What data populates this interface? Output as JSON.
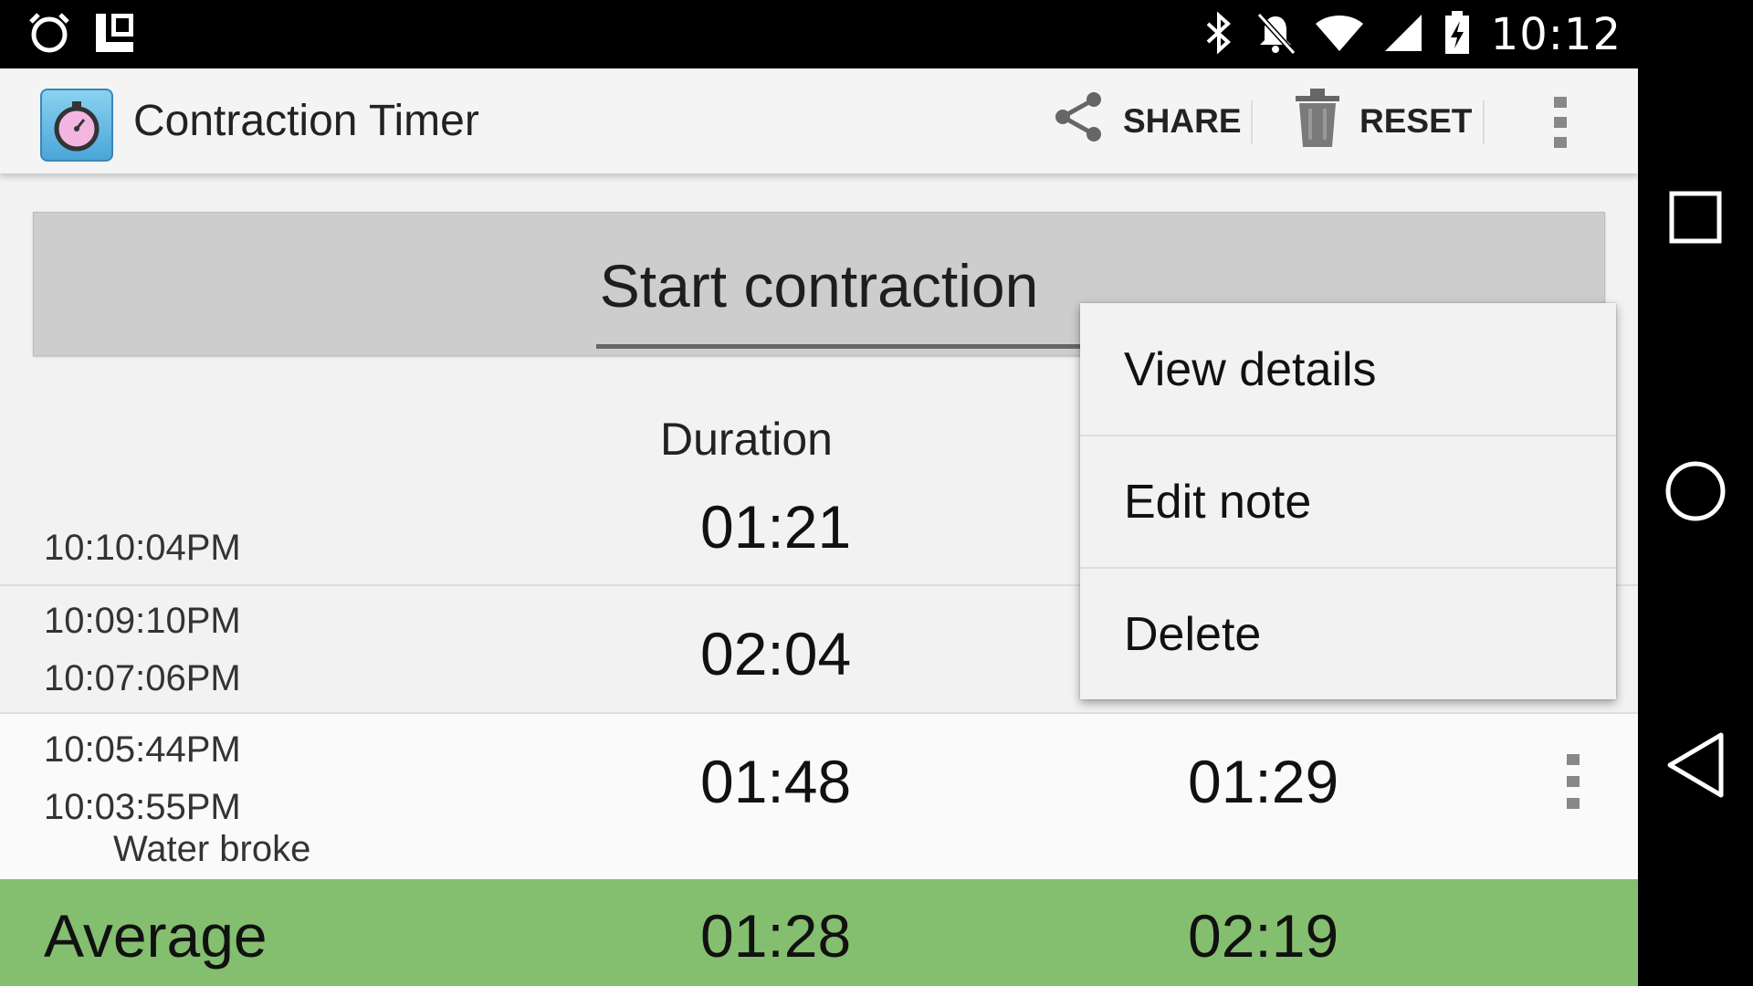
{
  "status_bar": {
    "time": "10:12",
    "left_icons": [
      "alarm-icon",
      "launcher-icon"
    ],
    "right_icons": [
      "bluetooth-icon",
      "notifications-off-icon",
      "wifi-icon",
      "cell-signal-icon",
      "battery-charging-icon"
    ]
  },
  "action_bar": {
    "title": "Contraction Timer",
    "share_label": "SHARE",
    "reset_label": "RESET"
  },
  "start_button": {
    "label": "Start contraction"
  },
  "list": {
    "header_duration": "Duration",
    "rows": [
      {
        "start": "",
        "end": "10:10:04PM",
        "duration": "01:21",
        "frequency": "",
        "note": ""
      },
      {
        "start": "10:09:10PM",
        "end": "10:07:06PM",
        "duration": "02:04",
        "frequency": "",
        "note": ""
      },
      {
        "start": "10:05:44PM",
        "end": "10:03:55PM",
        "duration": "01:48",
        "frequency": "01:29",
        "note": "Water broke"
      }
    ]
  },
  "average": {
    "label": "Average",
    "duration": "01:28",
    "frequency": "02:19"
  },
  "popup_menu": {
    "items": [
      "View details",
      "Edit note",
      "Delete"
    ]
  },
  "colors": {
    "average_bar": "#84bf6f",
    "action_bar": "#f4f4f4",
    "button": "#cdcdcd"
  }
}
